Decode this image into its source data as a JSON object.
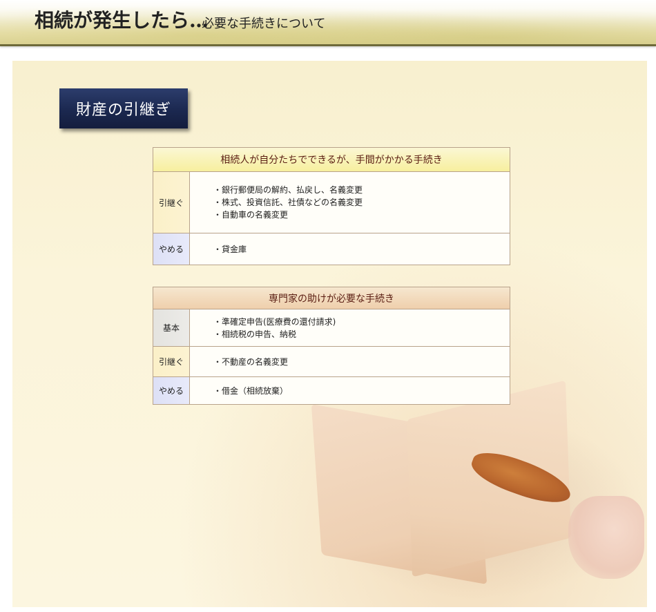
{
  "header": {
    "title_main": "相続が発生したら…",
    "title_sub": "必要な手続きについて"
  },
  "section": {
    "heading": "財産の引継ぎ"
  },
  "table1": {
    "title": "相続人が自分たちでできるが、手間がかかる手続き",
    "rows": [
      {
        "label": "引継ぐ",
        "items": [
          "・銀行郵便局の解約、払戻し、名義変更",
          "・株式、投資信託、社債などの名義変更",
          "・自動車の名義変更"
        ]
      },
      {
        "label": "やめる",
        "items": [
          "・貸金庫"
        ]
      }
    ]
  },
  "table2": {
    "title": "専門家の助けが必要な手続き",
    "rows": [
      {
        "label": "基本",
        "items": [
          "・準確定申告(医療費の還付請求)",
          "・相続税の申告、納税"
        ]
      },
      {
        "label": "引継ぐ",
        "items": [
          "・不動産の名義変更"
        ]
      },
      {
        "label": "やめる",
        "items": [
          "・借金（相続放棄）"
        ]
      }
    ]
  },
  "colors": {
    "heading_bg": "#1b2850",
    "table_border": "#b8a28a",
    "table_title_text": "#5a1d12"
  }
}
